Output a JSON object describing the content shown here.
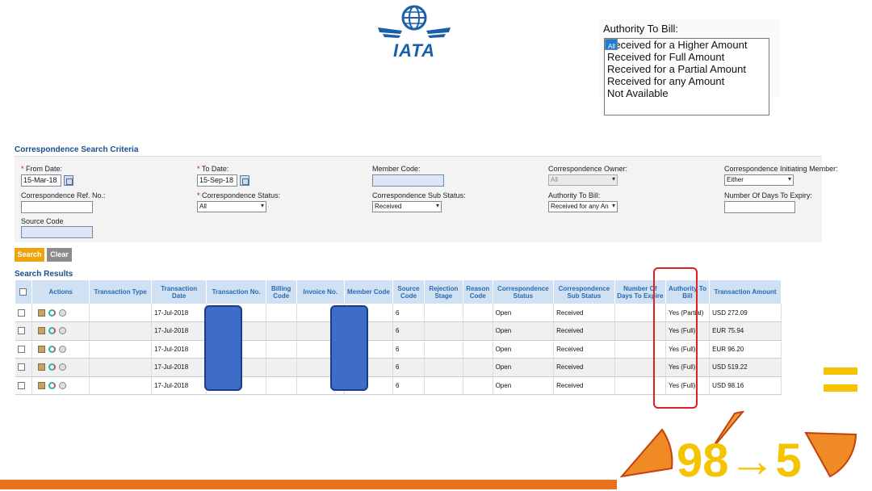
{
  "logo": {
    "text": "IATA"
  },
  "authority_popup": {
    "title": "Authority To Bill:",
    "options": [
      "All",
      "Received for a Higher Amount",
      "Received for Full Amount",
      "Received for a Partial Amount",
      "Received for any Amount",
      "Not Available"
    ],
    "selected_index": 0
  },
  "criteria": {
    "title": "Correspondence Search Criteria",
    "from_date_label": "From Date:",
    "from_date_value": "15-Mar-18",
    "to_date_label": "To Date:",
    "to_date_value": "15-Sep-18",
    "member_code_label": "Member Code:",
    "owner_label": "Correspondence Owner:",
    "owner_value": "All",
    "initiating_member_label": "Correspondence Initiating Member:",
    "initiating_member_value": "Either",
    "ref_no_label": "Correspondence Ref. No.:",
    "status_label": "Correspondence Status:",
    "status_value": "All",
    "sub_status_label": "Correspondence Sub Status:",
    "sub_status_value": "Received",
    "authority_label": "Authority To Bill:",
    "authority_value": "Received for any An",
    "days_expiry_label": "Number Of Days To Expiry:",
    "source_code_label": "Source Code"
  },
  "buttons": {
    "search": "Search",
    "clear": "Clear"
  },
  "results": {
    "title": "Search Results",
    "columns": [
      "",
      "Actions",
      "Transaction Type",
      "Transaction Date",
      "Transaction No.",
      "Billing Code",
      "Invoice No.",
      "Member Code",
      "Source Code",
      "Rejection Stage",
      "Reason Code",
      "Correspondence Status",
      "Correspondence Sub Status",
      "Number Of Days To Expire",
      "Authority To Bill",
      "Transaction Amount"
    ],
    "rows": [
      {
        "date": "17-Jul-2018",
        "source": "6",
        "status": "Open",
        "sub_status": "Received",
        "authority": "Yes (Partial)",
        "amount": "USD 272.09"
      },
      {
        "date": "17-Jul-2018",
        "source": "6",
        "status": "Open",
        "sub_status": "Received",
        "authority": "Yes (Full)",
        "amount": "EUR 75.94"
      },
      {
        "date": "17-Jul-2018",
        "source": "6",
        "status": "Open",
        "sub_status": "Received",
        "authority": "Yes (Full)",
        "amount": "EUR 96.20"
      },
      {
        "date": "17-Jul-2018",
        "source": "6",
        "status": "Open",
        "sub_status": "Received",
        "authority": "Yes (Full)",
        "amount": "USD 519.22"
      },
      {
        "date": "17-Jul-2018",
        "source": "6",
        "status": "Open",
        "sub_status": "Received",
        "authority": "Yes (Full)",
        "amount": "USD 98.16"
      }
    ]
  },
  "decoration": {
    "text": "98→5"
  },
  "colors": {
    "accent": "#f0a30a",
    "header": "#cfe1f3",
    "link": "#1a4f8b",
    "highlight": "#e02020",
    "bar": "#e7741b"
  }
}
